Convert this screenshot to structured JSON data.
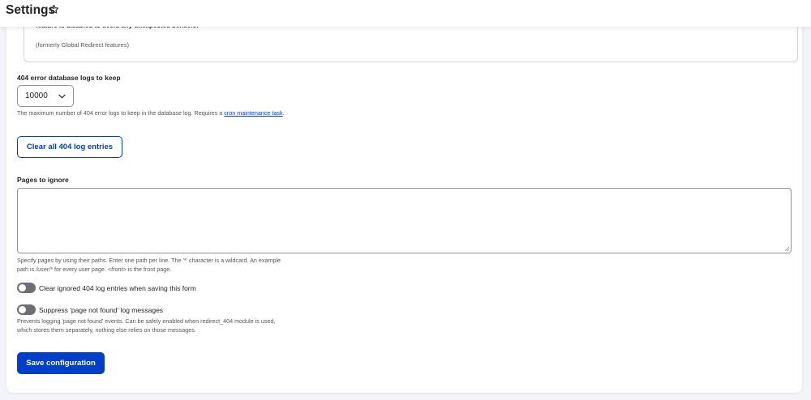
{
  "header": {
    "title": "Settings",
    "star_icon": "star-outline-icon"
  },
  "previous_section": {
    "bold_text": "feature is disabled to avoid any unexpected behavior",
    "note": "(formerly Global Redirect features)"
  },
  "log_retention": {
    "label": "404 error database logs to keep",
    "selected_value": "10000",
    "description_prefix": "The maximum number of 404 error logs to keep in the database log. Requires a ",
    "description_link": "cron maintenance task",
    "description_suffix": "."
  },
  "clear_button": {
    "label": "Clear all 404 log entries"
  },
  "pages_to_ignore": {
    "label": "Pages to ignore",
    "value": "",
    "description_line1": "Specify pages by using their paths. Enter one path per line. The '*' character is a wildcard. An example",
    "description_line2_a": "path is ",
    "description_line2_path": "/user/*",
    "description_line2_b": " for every user page. ",
    "description_line2_front": "<front>",
    "description_line2_c": " is the front page."
  },
  "toggles": [
    {
      "label": "Clear ignored 404 log entries when saving this form",
      "checked": false
    },
    {
      "label": "Suppress 'page not found' log messages",
      "checked": false,
      "description_line1": "Prevents logging 'page not found' events. Can be safely enabled when redirect_404 module is used,",
      "description_line2": "which stores them separately, nothing else relies on those messages."
    }
  ],
  "save_button": {
    "label": "Save configuration"
  },
  "colors": {
    "primary": "#003ecc",
    "toggle_off": "#6e6f75",
    "text": "#232429",
    "muted_text": "#55565b",
    "background": "#f3f4f9"
  }
}
